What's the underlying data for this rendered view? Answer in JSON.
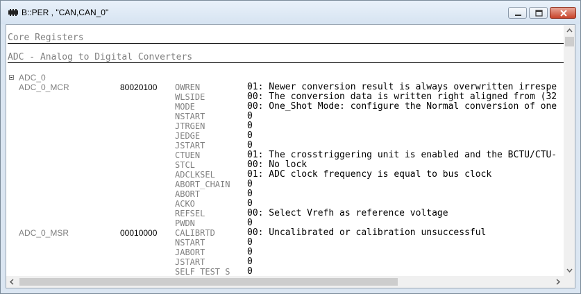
{
  "window": {
    "title": "B::PER , \"CAN,CAN_0\"",
    "icons": {
      "app": "per-window-icon",
      "minimize": "minimize-icon",
      "maximize": "maximize-icon",
      "close": "close-icon"
    }
  },
  "sections": {
    "core": "Core Registers",
    "adc": "ADC - Analog to Digital Converters"
  },
  "group": {
    "label": "ADC_0",
    "expanded_icon": "minus-box-icon"
  },
  "registers": [
    {
      "name": "ADC_0_MCR",
      "value": "80020100",
      "fields": [
        {
          "name": "OWREN",
          "value": "01: Newer conversion result is always overwritten irrespe"
        },
        {
          "name": "WLSIDE",
          "value": "00: The conversion data is written right aligned from (32"
        },
        {
          "name": "MODE",
          "value": "00: One_Shot Mode: configure the Normal conversion of one"
        },
        {
          "name": "NSTART",
          "value": "0"
        },
        {
          "name": "JTRGEN",
          "value": "0"
        },
        {
          "name": "JEDGE",
          "value": "0"
        },
        {
          "name": "JSTART",
          "value": "0"
        },
        {
          "name": "CTUEN",
          "value": "01: The crosstriggering unit is enabled and the BCTU/CTU-"
        },
        {
          "name": "STCL",
          "value": "00: No lock"
        },
        {
          "name": "ADCLKSEL",
          "value": "01: ADC clock frequency is equal to bus clock"
        },
        {
          "name": "ABORT_CHAIN",
          "value": "0"
        },
        {
          "name": "ABORT",
          "value": "0"
        },
        {
          "name": "ACKO",
          "value": "0"
        },
        {
          "name": "REFSEL",
          "value": "00: Select Vrefh as reference voltage"
        },
        {
          "name": "PWDN",
          "value": "0"
        }
      ]
    },
    {
      "name": "ADC_0_MSR",
      "value": "00010000",
      "fields": [
        {
          "name": "CALIBRTD",
          "value": "00: Uncalibrated or calibration unsuccessful"
        },
        {
          "name": "NSTART",
          "value": "0"
        },
        {
          "name": "JABORT",
          "value": "0"
        },
        {
          "name": "JSTART",
          "value": "0"
        },
        {
          "name": "SELF_TEST_S",
          "value": "0"
        }
      ]
    }
  ],
  "scroll": {
    "up": "scroll-up-arrow-icon",
    "down": "scroll-down-arrow-icon",
    "left": "scroll-left-arrow-icon",
    "right": "scroll-right-arrow-icon"
  }
}
